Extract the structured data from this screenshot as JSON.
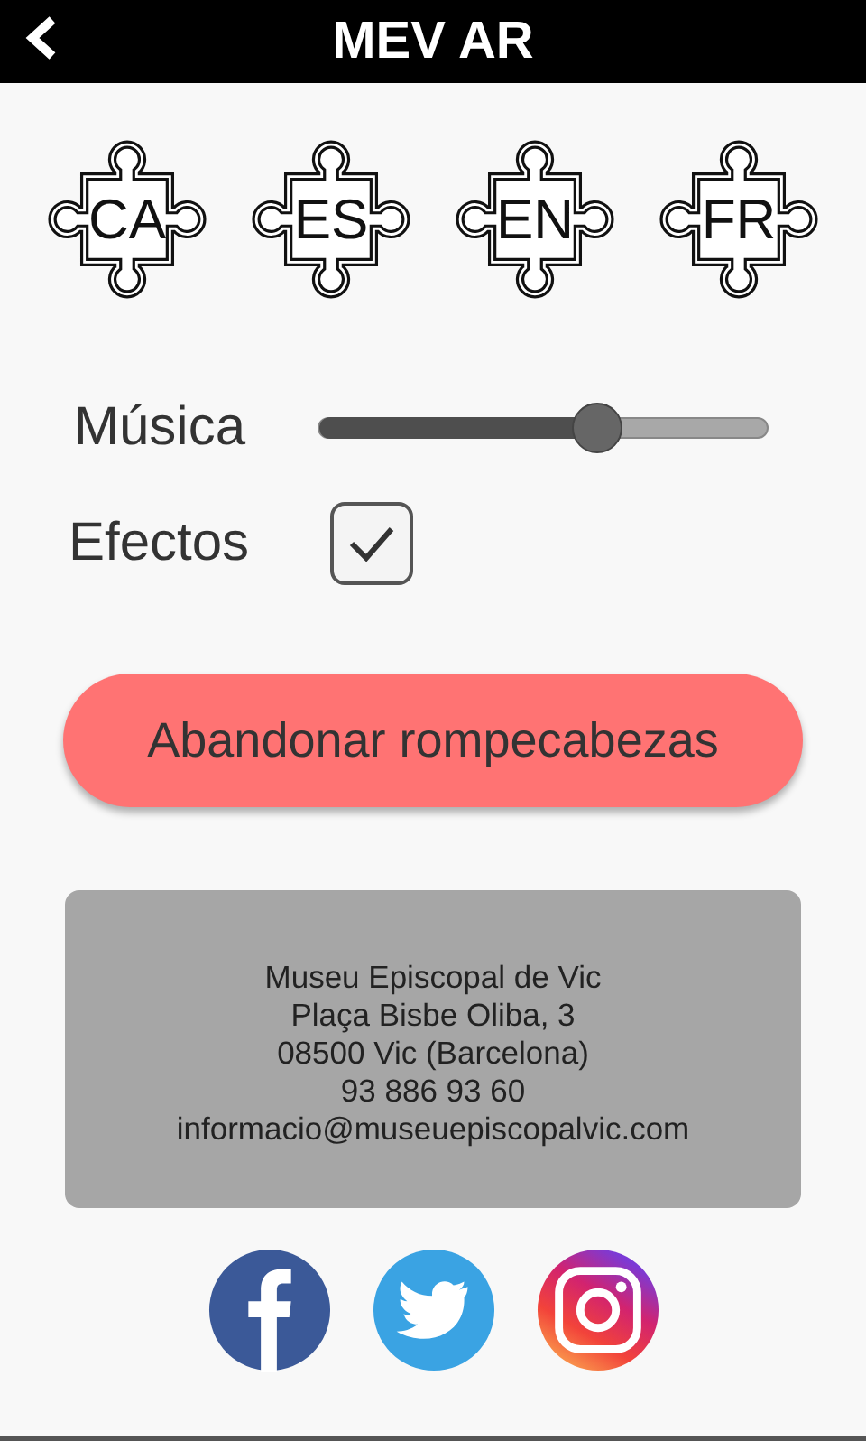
{
  "header": {
    "title": "MEV AR"
  },
  "languages": [
    {
      "code": "CA"
    },
    {
      "code": "ES"
    },
    {
      "code": "EN"
    },
    {
      "code": "FR"
    }
  ],
  "settings": [
    {
      "kind": "slider",
      "label": "Música",
      "level": 0.62
    },
    {
      "kind": "checkbox",
      "label": "Efectos",
      "checked": true
    }
  ],
  "action_button": "Abandonar rompecabezas",
  "contact": [
    "Museu Episcopal de Vic",
    "Plaça Bisbe Oliba, 3",
    "08500 Vic (Barcelona)",
    "93 886 93 60",
    "informacio@museuepiscopalvic.com"
  ],
  "social": [
    {
      "kind": "facebook"
    },
    {
      "kind": "twitter"
    },
    {
      "kind": "instagram"
    }
  ]
}
